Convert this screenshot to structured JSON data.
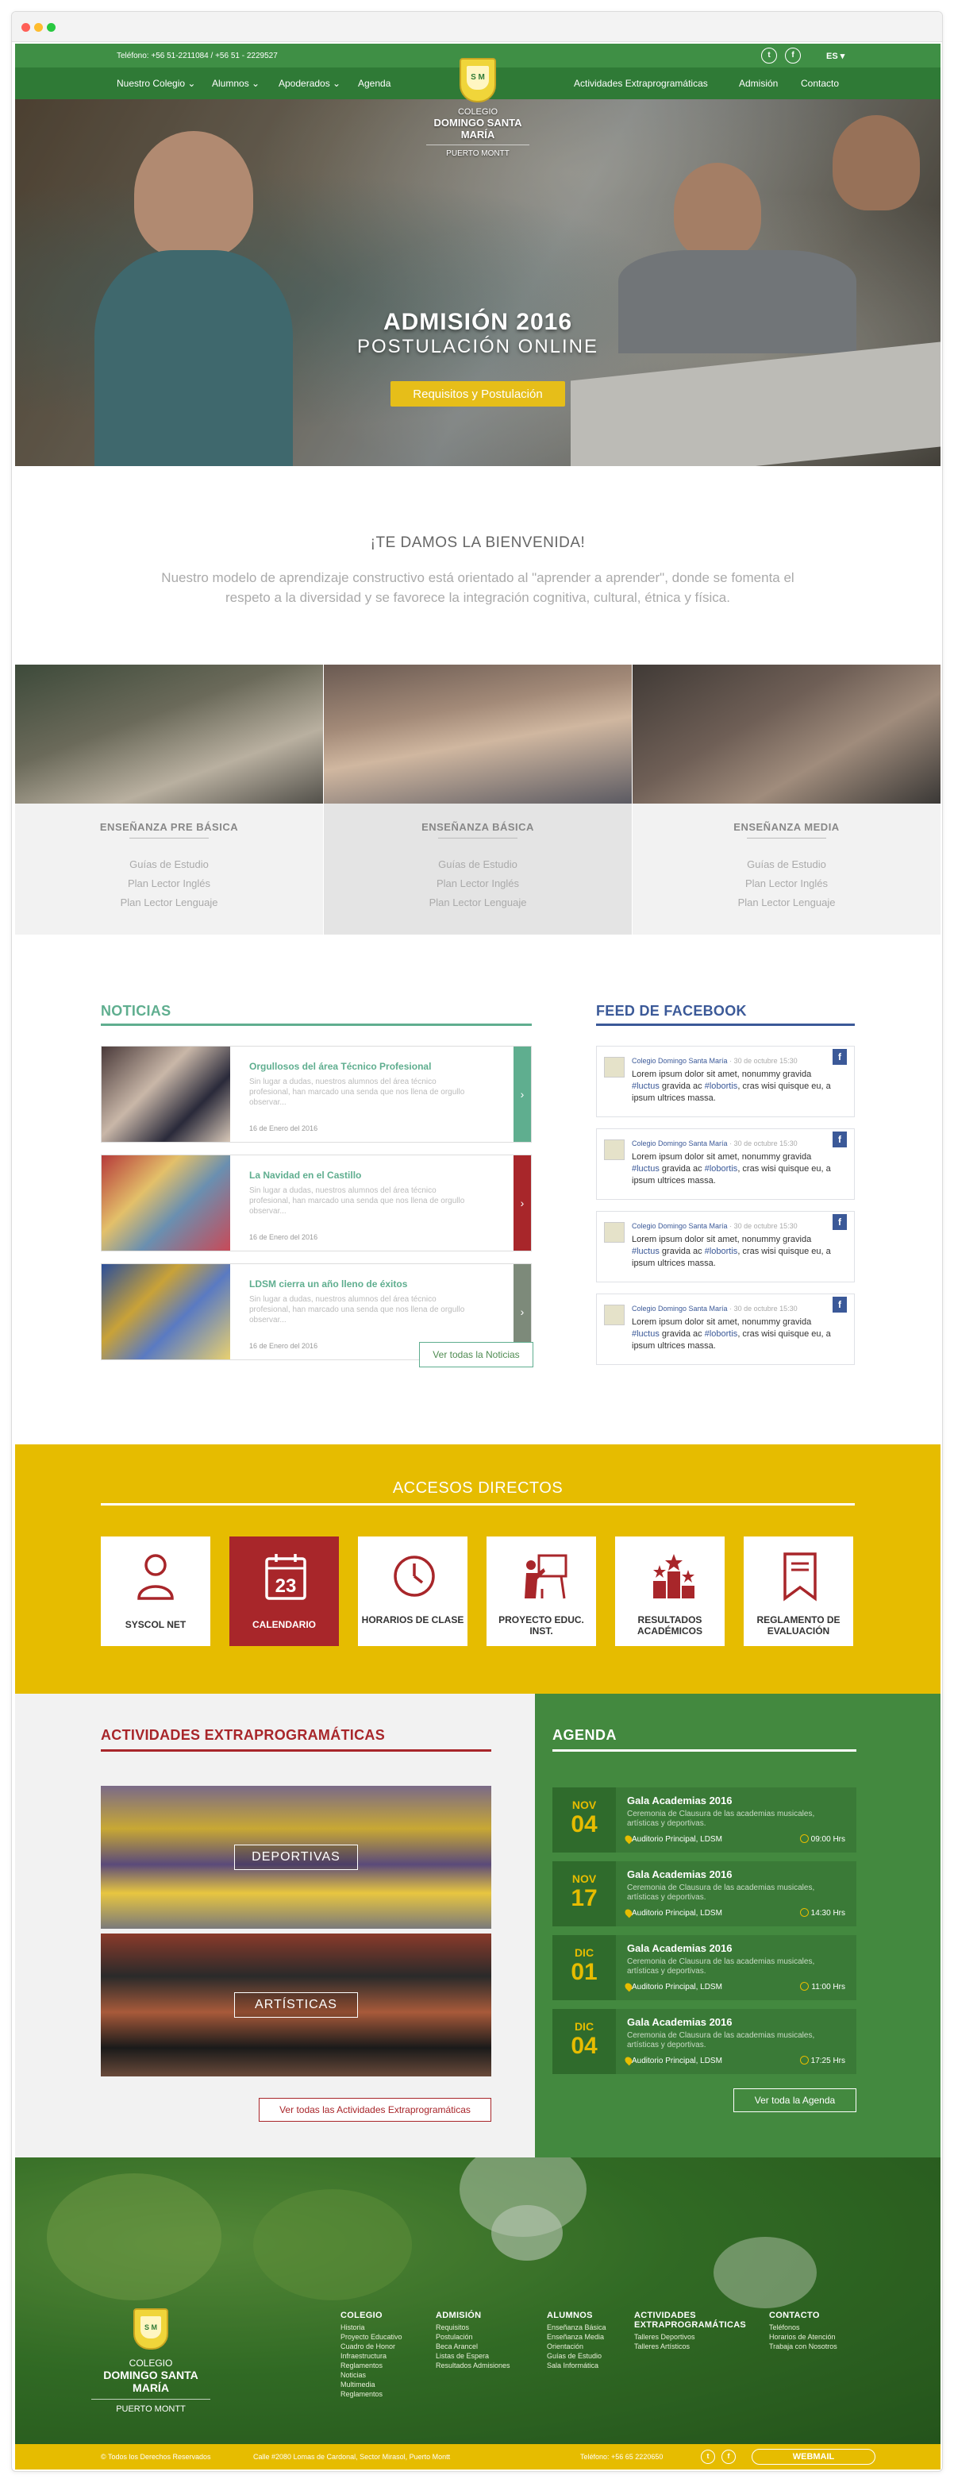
{
  "topbar": {
    "phone": "Teléfono: +56 51-2211084 / +56 51 - 2229527",
    "twitter_icon": "twitter-icon",
    "facebook_icon": "facebook-icon",
    "language": "ES ▾"
  },
  "nav": {
    "left": [
      "Nuestro Colegio ⌄",
      "Alumnos ⌄",
      "Apoderados ⌄",
      "Agenda"
    ],
    "right": [
      "Actividades Extraprogramáticas",
      "Admisión",
      "Contacto"
    ]
  },
  "logo": {
    "line1": "COLEGIO",
    "line2": "DOMINGO SANTA MARÍA",
    "line3": "PUERTO MONTT",
    "crest_text": "S M"
  },
  "hero": {
    "title": "ADMISIÓN 2016",
    "subtitle": "POSTULACIÓN ONLINE",
    "button": "Requisitos y Postulación"
  },
  "welcome": {
    "title": "¡TE DAMOS LA BIENVENIDA!",
    "text": "Nuestro modelo de aprendizaje constructivo está orientado al \"aprender a aprender\", donde se fomenta el respeto a la diversidad y se favorece la integración cognitiva, cultural, étnica y física."
  },
  "levels": [
    {
      "title": "ENSEÑANZA  PRE BÁSICA",
      "links": [
        "Guías de Estudio",
        "Plan Lector Inglés",
        "Plan Lector Lenguaje"
      ]
    },
    {
      "title": "ENSEÑANZA BÁSICA",
      "links": [
        "Guías de Estudio",
        "Plan Lector Inglés",
        "Plan Lector Lenguaje"
      ]
    },
    {
      "title": "ENSEÑANZA MEDIA",
      "links": [
        "Guías de Estudio",
        "Plan Lector Inglés",
        "Plan Lector Lenguaje"
      ]
    }
  ],
  "news": {
    "title": "NOTICIAS",
    "items": [
      {
        "title": "Orgullosos del área Técnico Profesional",
        "text": "Sin lugar a dudas, nuestros alumnos del área técnico profesional, han marcado una senda que nos llena de orgullo observar...",
        "date": "16 de  Enero del 2016",
        "color": "#5fae8f"
      },
      {
        "title": "La Navidad en el Castillo",
        "text": "Sin lugar a dudas, nuestros alumnos del área técnico profesional, han marcado una senda que nos llena de orgullo observar...",
        "date": "16 de  Enero del 2016",
        "color": "#a8262a"
      },
      {
        "title": "LDSM cierra un año lleno de éxitos",
        "text": "Sin lugar a dudas, nuestros alumnos del área técnico profesional, han marcado una senda que nos llena de orgullo observar...",
        "date": "16 de  Enero del 2016",
        "color": "#7d8a7a"
      }
    ],
    "arrow": "›",
    "button": "Ver todas la Noticias"
  },
  "facebook": {
    "title": "FEED DE FACEBOOK",
    "posts": [
      {
        "author": "Colegio Domingo Santa María",
        "time": " · 30 de octubre 15:30",
        "pre": "Lorem ipsum dolor sit amet, nonummy gravida ",
        "tag1": "#luctus",
        "mid": " gravida ac ",
        "tag2": "#lobortis",
        "post": ", cras wisi quisque eu, a ipsum ultrices massa."
      },
      {
        "author": "Colegio Domingo Santa María",
        "time": " · 30 de octubre 15:30",
        "pre": "Lorem ipsum dolor sit amet, nonummy gravida ",
        "tag1": "#luctus",
        "mid": " gravida ac ",
        "tag2": "#lobortis",
        "post": ", cras wisi quisque eu, a ipsum ultrices massa."
      },
      {
        "author": "Colegio Domingo Santa María",
        "time": " · 30 de octubre 15:30",
        "pre": "Lorem ipsum dolor sit amet, nonummy gravida ",
        "tag1": "#luctus",
        "mid": " gravida ac ",
        "tag2": "#lobortis",
        "post": ", cras wisi quisque eu, a ipsum ultrices massa."
      },
      {
        "author": "Colegio Domingo Santa María",
        "time": " · 30 de octubre 15:30",
        "pre": "Lorem ipsum dolor sit amet, nonummy gravida ",
        "tag1": "#luctus",
        "mid": " gravida ac ",
        "tag2": "#lobortis",
        "post": ", cras wisi quisque eu, a ipsum ultrices massa."
      }
    ]
  },
  "accesos": {
    "title": "ACCESOS DIRECTOS",
    "calendar_day": "23",
    "tiles": [
      {
        "label": "SYSCOL NET",
        "icon": "user-icon"
      },
      {
        "label": "CALENDARIO",
        "icon": "calendar-icon"
      },
      {
        "label": "HORARIOS DE CLASE",
        "icon": "clock-icon"
      },
      {
        "label": "PROYECTO EDUC. INST.",
        "icon": "presentation-icon"
      },
      {
        "label": "RESULTADOS ACADÉMICOS",
        "icon": "podium-icon"
      },
      {
        "label": "REGLAMENTO DE EVALUACIÓN",
        "icon": "bookmark-icon"
      }
    ]
  },
  "extra": {
    "title": "ACTIVIDADES EXTRAPROGRAMÁTICAS",
    "items": [
      "DEPORTIVAS",
      "ARTÍSTICAS"
    ],
    "button": "Ver todas las Actividades Extraprogramáticas"
  },
  "agenda": {
    "title": "AGENDA",
    "events": [
      {
        "month": "NOV",
        "day": "04",
        "title": "Gala Academias 2016",
        "text": "Ceremonia de Clausura de las academias musicales, artísticas y deportivas.",
        "place": "Auditorio Principal, LDSM",
        "time": "09:00 Hrs"
      },
      {
        "month": "NOV",
        "day": "17",
        "title": "Gala Academias 2016",
        "text": "Ceremonia de Clausura de las academias musicales, artísticas y deportivas.",
        "place": "Auditorio Principal, LDSM",
        "time": "14:30 Hrs"
      },
      {
        "month": "DIC",
        "day": "01",
        "title": "Gala Academias 2016",
        "text": "Ceremonia de Clausura de las academias musicales, artísticas y deportivas.",
        "place": "Auditorio Principal, LDSM",
        "time": "11:00 Hrs"
      },
      {
        "month": "DIC",
        "day": "04",
        "title": "Gala Academias 2016",
        "text": "Ceremonia de Clausura de las academias musicales, artísticas y deportivas.",
        "place": "Auditorio Principal, LDSM",
        "time": "17:25 Hrs"
      }
    ],
    "button": "Ver toda la Agenda"
  },
  "footer": {
    "colegio": {
      "title": "COLEGIO",
      "links": [
        "Historia",
        "Proyecto Educativo",
        "Cuadro de Honor",
        "Infraestructura",
        "Reglamentos",
        "Noticias",
        "Multimedia",
        "Reglamentos"
      ]
    },
    "admision": {
      "title": "ADMISIÓN",
      "links": [
        "Requisitos",
        "Postulación",
        "Beca Arancel",
        "Listas de Espera",
        "Resultados Admisiones"
      ]
    },
    "alumnos": {
      "title": "ALUMNOS",
      "links": [
        "Enseñanza Básica",
        "Enseñanza Media",
        "Orientación",
        "Guías de Estudio",
        "Sala Informática"
      ]
    },
    "actividades": {
      "title1": "ACTIVIDADES",
      "title2": "EXTRAPROGRAMÁTICAS",
      "links": [
        "Talleres Deportivos",
        "Talleres Artísticos"
      ]
    },
    "contacto": {
      "title": "CONTACTO",
      "links": [
        "Teléfonos",
        "Horarios de Atención",
        "Trabaja con Nosotros"
      ]
    },
    "copyright": "© Todos los Derechos Reservados",
    "address": "Calle #2080 Lomas de Cardonal, Sector Mirasol, Puerto Montt",
    "phone": "Teléfono: +56 65 2220650",
    "webmail": "WEBMAIL"
  },
  "colors": {
    "green": "#43893f",
    "yellow": "#e6bc00",
    "red": "#a8262a",
    "teal": "#5fae8f",
    "facebook": "#3b5998"
  }
}
